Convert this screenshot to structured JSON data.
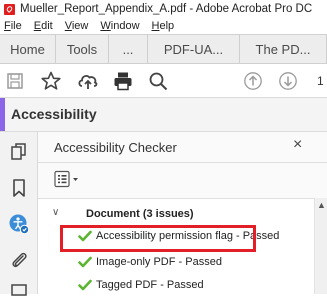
{
  "window": {
    "title": "Mueller_Report_Appendix_A.pdf - Adobe Acrobat Pro DC"
  },
  "menu": [
    {
      "label": "File"
    },
    {
      "label": "Edit"
    },
    {
      "label": "View"
    },
    {
      "label": "Window"
    },
    {
      "label": "Help"
    }
  ],
  "tabs": [
    {
      "label": "Home"
    },
    {
      "label": "Tools"
    },
    {
      "label": "..."
    },
    {
      "label": "PDF-UA..."
    },
    {
      "label": "The PD..."
    }
  ],
  "toolbar": {
    "page_number": "1",
    "icons": [
      "save-icon",
      "bookmark-star-icon",
      "upload-cloud-icon",
      "print-icon",
      "zoom-icon",
      "previous-page-icon",
      "next-page-icon"
    ]
  },
  "header": {
    "title": "Accessibility",
    "accent_color": "#8b67e8"
  },
  "panel": {
    "title": "Accessibility Checker",
    "close_label": "×",
    "options_icon": "options-menu-icon"
  },
  "tree": {
    "group_label": "Document (3 issues)",
    "items": [
      {
        "label": "Accessibility permission flag - Passed",
        "status": "passed"
      },
      {
        "label": "Image-only PDF - Passed",
        "status": "passed"
      },
      {
        "label": "Tagged PDF - Passed",
        "status": "passed"
      }
    ]
  },
  "colors": {
    "highlight": "#e21f26",
    "check": "#5cb531"
  }
}
